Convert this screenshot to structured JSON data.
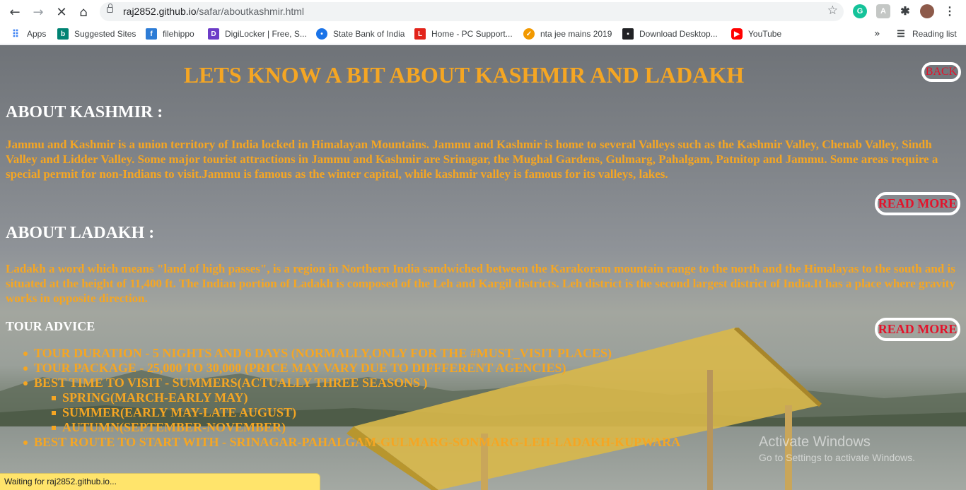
{
  "browser": {
    "url_host": "raj2852.github.io",
    "url_path": "/safar/aboutkashmir.html",
    "bookmarks": [
      {
        "label": "Apps",
        "icon": "apps-grid-icon",
        "color": "#4285f4"
      },
      {
        "label": "Suggested Sites",
        "icon": "bing-icon",
        "color": "#008373"
      },
      {
        "label": "filehippo",
        "icon": "filehippo-icon",
        "color": "#2d7cd6"
      },
      {
        "label": "DigiLocker | Free, S...",
        "icon": "digilocker-icon",
        "color": "#6c3cc7"
      },
      {
        "label": "State Bank of India",
        "icon": "sbi-icon",
        "color": "#1a73e8"
      },
      {
        "label": "Home - PC Support...",
        "icon": "lenovo-icon",
        "color": "#e2231a"
      },
      {
        "label": "nta jee mains 2019",
        "icon": "check-circle-icon",
        "color": "#f29900"
      },
      {
        "label": "Download Desktop...",
        "icon": "desktop-icon",
        "color": "#202124"
      },
      {
        "label": "YouTube",
        "icon": "youtube-icon",
        "color": "#ff0000"
      }
    ],
    "reading_list": "Reading list",
    "status": "Waiting for raj2852.github.io..."
  },
  "page": {
    "heading": "LETS KNOW A BIT ABOUT KASHMIR AND LADAKH",
    "back_label": "BACK",
    "kashmir_title": "ABOUT KASHMIR :",
    "kashmir_text": "Jammu and Kashmir is a union territory of India locked in Himalayan Mountains. Jammu and Kashmir is home to several Valleys such as the Kashmir Valley, Chenab Valley, Sindh Valley and Lidder Valley. Some major tourist attractions in Jammu and Kashmir are Srinagar, the Mughal Gardens, Gulmarg, Pahalgam, Patnitop and Jammu. Some areas require a special permit for non-Indians to visit.Jammu is famous as the winter capital, while kashmir valley is famous for its valleys, lakes.",
    "read_more_label": "READ MORE",
    "ladakh_title": "ABOUT LADAKH :",
    "ladakh_text": "Ladakh a word which means \"land of high passes\", is a region in Northern India sandwiched between the Karakoram mountain range to the north and the Himalayas to the south and is situated at the height of 11,400 ft. The Indian portion of Ladakh is composed of the Leh and Kargil districts. Leh district is the second largest district of India.It has a place where gravity works in opposite direction.",
    "advice_title": "TOUR ADVICE",
    "advice": {
      "duration": "TOUR DURATION - 5 NIGHTS AND 6 DAYS (NORMALLY,ONLY FOR THE #MUST_VISIT PLACES)",
      "package": "TOUR PACKAGE - 25,000 TO 30,000 (PRICE MAY VARY DUE TO DIFFFERENT AGENCIES)",
      "best_time": "BEST TIME TO VISIT - SUMMERS(ACTUALLY THREE SEASONS )",
      "seasons": [
        "SPRING(MARCH-EARLY MAY)",
        "SUMMER(EARLY MAY-LATE AUGUST)",
        "AUTUMN(SEPTEMBER-NOVEMBER)"
      ],
      "route": "BEST ROUTE TO START WITH - SRINAGAR-PAHALGAM-GULMARG-SONMARG-LEH-LADAKH-KUPWARA"
    },
    "watermark_title": "Activate Windows",
    "watermark_sub": "Go to Settings to activate Windows."
  },
  "colors": {
    "heading": "#f5a623",
    "button_text": "#e3132b",
    "section_title": "#ffffff",
    "status_bar": "#ffe46b"
  }
}
